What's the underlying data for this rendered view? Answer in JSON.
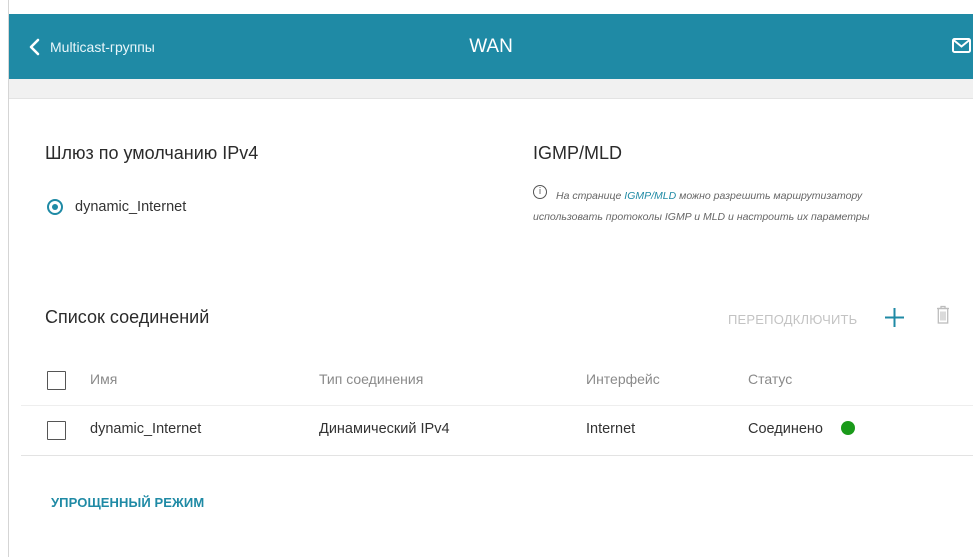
{
  "header": {
    "back_label": "Multicast-группы",
    "title": "WAN"
  },
  "gateway": {
    "heading": "Шлюз по умолчанию IPv4",
    "selected_option": "dynamic_Internet"
  },
  "igmp": {
    "heading": "IGMP/MLD",
    "info_prefix": "На странице ",
    "info_link": "IGMP/MLD",
    "info_suffix": " можно разрешить маршрутизатору использовать протоколы IGMP и MLD и настроить их параметры"
  },
  "connections": {
    "heading": "Список соединений",
    "reconnect_label": "ПЕРЕПОДКЛЮЧИТЬ",
    "columns": [
      "Имя",
      "Тип соединения",
      "Интерфейс",
      "Статус"
    ],
    "rows": [
      {
        "name": "dynamic_Internet",
        "type": "Динамический IPv4",
        "interface": "Internet",
        "status": "Соединено",
        "status_color": "#1a9a1a"
      }
    ]
  },
  "footer": {
    "simple_mode_label": "УПРОЩЕННЫЙ РЕЖИМ"
  },
  "colors": {
    "accent": "#1f8aa5",
    "status_ok": "#1a9a1a"
  },
  "icons": {
    "back": "chevron-left-icon",
    "mail": "mail-icon",
    "info": "info-icon",
    "add": "plus-icon",
    "delete": "trash-icon"
  }
}
